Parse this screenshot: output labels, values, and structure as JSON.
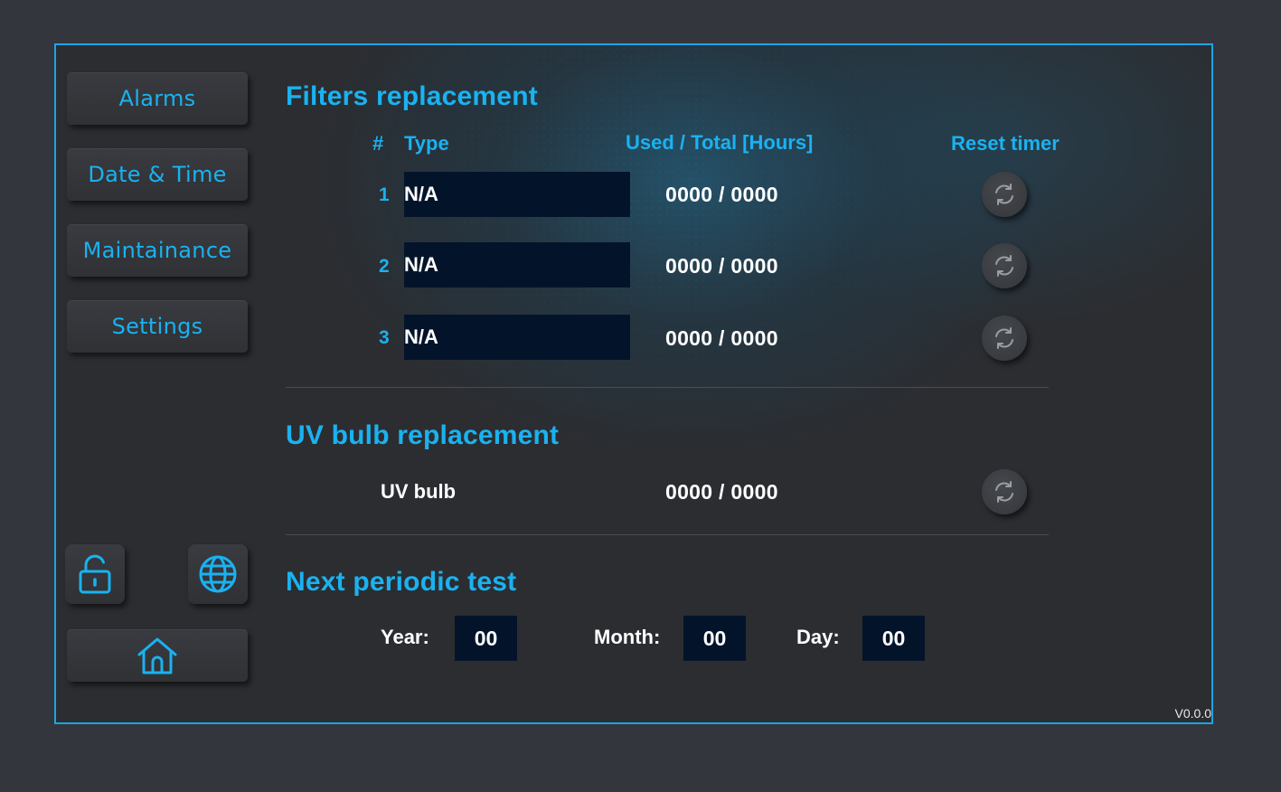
{
  "sidebar": {
    "items": [
      {
        "label": "Alarms"
      },
      {
        "label": "Date & Time"
      },
      {
        "label": "Maintainance"
      },
      {
        "label": "Settings"
      }
    ],
    "icons": [
      "unlock-icon",
      "globe-icon",
      "home-icon"
    ]
  },
  "filters": {
    "title": "Filters replacement",
    "headers": {
      "number": "#",
      "type": "Type",
      "used_total": "Used / Total [Hours]",
      "reset": "Reset timer"
    },
    "rows": [
      {
        "num": "1",
        "type": "N/A",
        "hours": "0000 / 0000"
      },
      {
        "num": "2",
        "type": "N/A",
        "hours": "0000 / 0000"
      },
      {
        "num": "3",
        "type": "N/A",
        "hours": "0000 / 0000"
      }
    ]
  },
  "uv": {
    "title": "UV bulb replacement",
    "label": "UV bulb",
    "hours": "0000 / 0000"
  },
  "periodic_test": {
    "title": "Next periodic test",
    "year_label": "Year:",
    "year": "00",
    "month_label": "Month:",
    "month": "00",
    "day_label": "Day:",
    "day": "00"
  },
  "version": "V0.0.0",
  "colors": {
    "accent": "#1ab2f0",
    "field_bg": "#03142a",
    "border": "#1aa6e8"
  }
}
